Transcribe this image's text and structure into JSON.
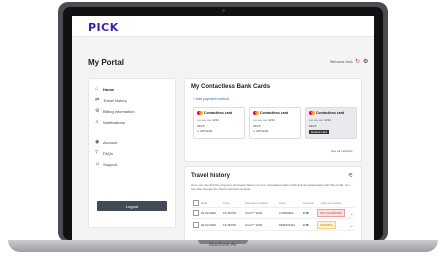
{
  "app": {
    "logo": "PICK",
    "title": "My Portal",
    "user_link": "Welcome Jack"
  },
  "icons": {
    "refresh": "refresh-icon",
    "settings": "gear-icon",
    "filter": "filter-icon"
  },
  "sidebar": {
    "items": [
      {
        "icon": "⌂",
        "label": "Home"
      },
      {
        "icon": "⇄",
        "label": "Travel history"
      },
      {
        "icon": "⚙",
        "label": "Billing information"
      },
      {
        "icon": "♫",
        "label": "Notifications"
      },
      {
        "icon": "◉",
        "label": "Account"
      },
      {
        "icon": "?",
        "label": "FAQs"
      },
      {
        "icon": "☺",
        "label": "Support"
      }
    ],
    "logout": "Logout"
  },
  "cards": {
    "title": "My Contactless Bank Cards",
    "add": "+  Add payment method",
    "see_all": "See all methods",
    "items": [
      {
        "label": "Contactless card",
        "number": "•••• •••• •••• 1234",
        "expiry": "09/25",
        "name": "J. ARTHUR"
      },
      {
        "label": "Contactless card",
        "number": "•••• •••• •••• 1234",
        "expiry": "09/25",
        "name": "J. ARTHUR"
      },
      {
        "label": "Contactless card",
        "number": "•••• •••• •••• 1234",
        "expiry": "09/25",
        "badge": "Default card"
      }
    ]
  },
  "travel": {
    "title": "Travel history",
    "description": "Here you can find the payment and travel history of your contactless bank cards that are associated with this portal. You can also change the Tax/Cl-Account receipts.",
    "columns": [
      "Date",
      "Time",
      "Payment method",
      "Zone",
      "Amount",
      "Payment status"
    ],
    "rows": [
      {
        "date": "02.02.2022",
        "time": "12:38 PM",
        "method": "Card ** 1234",
        "zone": "LONDRES",
        "amount": "2,7€",
        "status": "NOT ACCEPTED"
      },
      {
        "date": "02.02.2022",
        "time": "12:38 PM",
        "method": "Card ** 1234",
        "zone": "PERSONAL",
        "amount": "2,7€",
        "status": "PENDING"
      }
    ]
  },
  "device": {
    "label": "MacBook Air"
  }
}
